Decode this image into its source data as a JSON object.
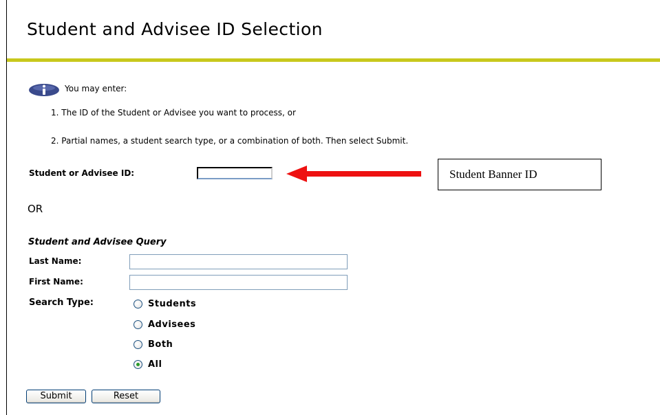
{
  "page": {
    "title": "Student and Advisee ID Selection",
    "accent_color": "#c8c81c"
  },
  "info": {
    "icon": "info-icon",
    "intro": "You may enter:",
    "instructions": [
      "1. The ID of the Student or Advisee you want to process, or",
      "2. Partial names, a student search type, or a combination of both. Then select Submit."
    ]
  },
  "id_section": {
    "label": "Student or Advisee ID:",
    "value": "",
    "annotation": {
      "text": "Student Banner ID",
      "arrow_color": "#ee1111"
    }
  },
  "separator": "OR",
  "query": {
    "heading": "Student and Advisee Query",
    "last_name": {
      "label": "Last Name:",
      "value": ""
    },
    "first_name": {
      "label": "First Name:",
      "value": ""
    },
    "search_type": {
      "label": "Search Type:",
      "options": [
        {
          "label": "Students",
          "checked": false
        },
        {
          "label": "Advisees",
          "checked": false
        },
        {
          "label": "Both",
          "checked": false
        },
        {
          "label": "All",
          "checked": true
        }
      ]
    }
  },
  "buttons": {
    "submit": "Submit",
    "reset": "Reset"
  }
}
